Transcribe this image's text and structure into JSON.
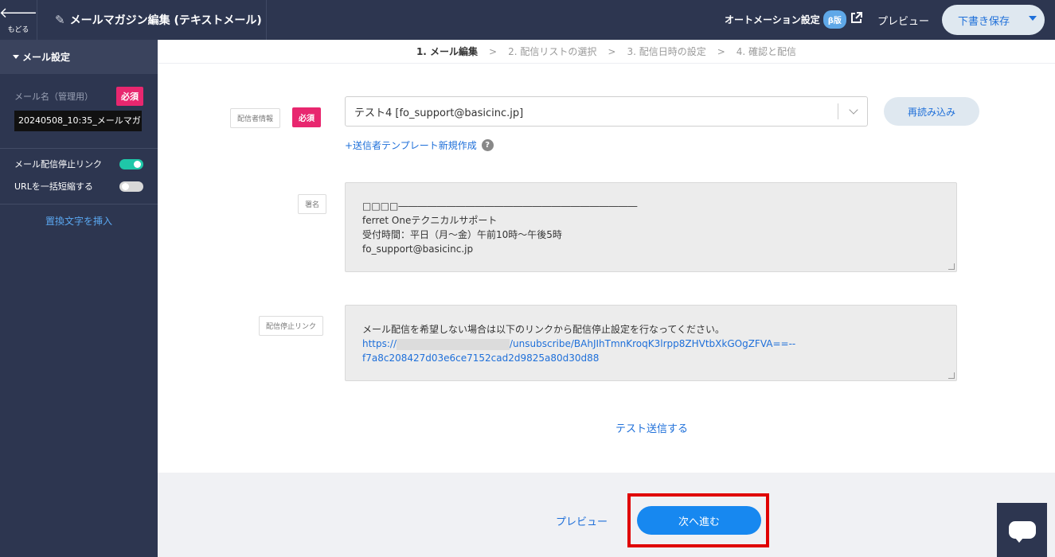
{
  "header": {
    "back_label": "もどる",
    "title": "メールマガジン編集 (テキストメール)",
    "automation_label": "オートメーション設定",
    "beta_badge": "β版",
    "preview_label": "プレビュー",
    "save_label": "下書き保存"
  },
  "sidebar": {
    "section_title": "メール設定",
    "mail_name_label": "メール名（管理用）",
    "required_badge": "必須",
    "mail_name_value": "20240508_10:35_メールマガ",
    "unsubscribe_toggle_label": "メール配信停止リンク",
    "unsubscribe_toggle_on": true,
    "url_shorten_label": "URLを一括短縮する",
    "url_shorten_on": false,
    "insert_text_link": "置換文字を挿入"
  },
  "stepper": {
    "steps": [
      "1. メール編集",
      "2. 配信リストの選択",
      "3. 配信日時の設定",
      "4. 確認と配信"
    ],
    "separator": ">",
    "active_index": 0
  },
  "form": {
    "sender_label": "配信者情報",
    "required_badge": "必須",
    "sender_value": "テスト4 [fo_support@basicinc.jp]",
    "reload_label": "再読み込み",
    "new_template_link": "+送信者テンプレート新規作成",
    "help_icon": "?",
    "signature_label": "署名",
    "signature_lines": [
      "□□□□―――――――――――――――――――――――――",
      "ferret Oneテクニカルサポート",
      "受付時間：平日（月～金）午前10時～午後5時",
      "fo_support@basicinc.jp"
    ],
    "unsubscribe_label": "配信停止リンク",
    "unsubscribe_text": "メール配信を希望しない場合は以下のリンクから配信停止設定を行なってください。",
    "unsubscribe_url_prefix": "https://",
    "unsubscribe_url_suffix": "/unsubscribe/BAhJIhTmnKroqK3lrpp8ZHVtbXkGOgZFVA==--",
    "unsubscribe_url_line2": "f7a8c208427d03e6ce7152cad2d9825a80d30d88",
    "test_send_link": "テスト送信する"
  },
  "footer": {
    "preview_label": "プレビュー",
    "next_label": "次へ進む"
  },
  "colors": {
    "nav_bg": "#2d3650",
    "accent_blue": "#1788f0",
    "required_pink": "#e8276f",
    "toggle_on": "#1fc7a8",
    "highlight_red": "#e00000"
  },
  "icons": {
    "back": "arrow-left-icon",
    "title": "pencil-icon",
    "external": "external-link-icon",
    "chat": "chat-icon"
  }
}
